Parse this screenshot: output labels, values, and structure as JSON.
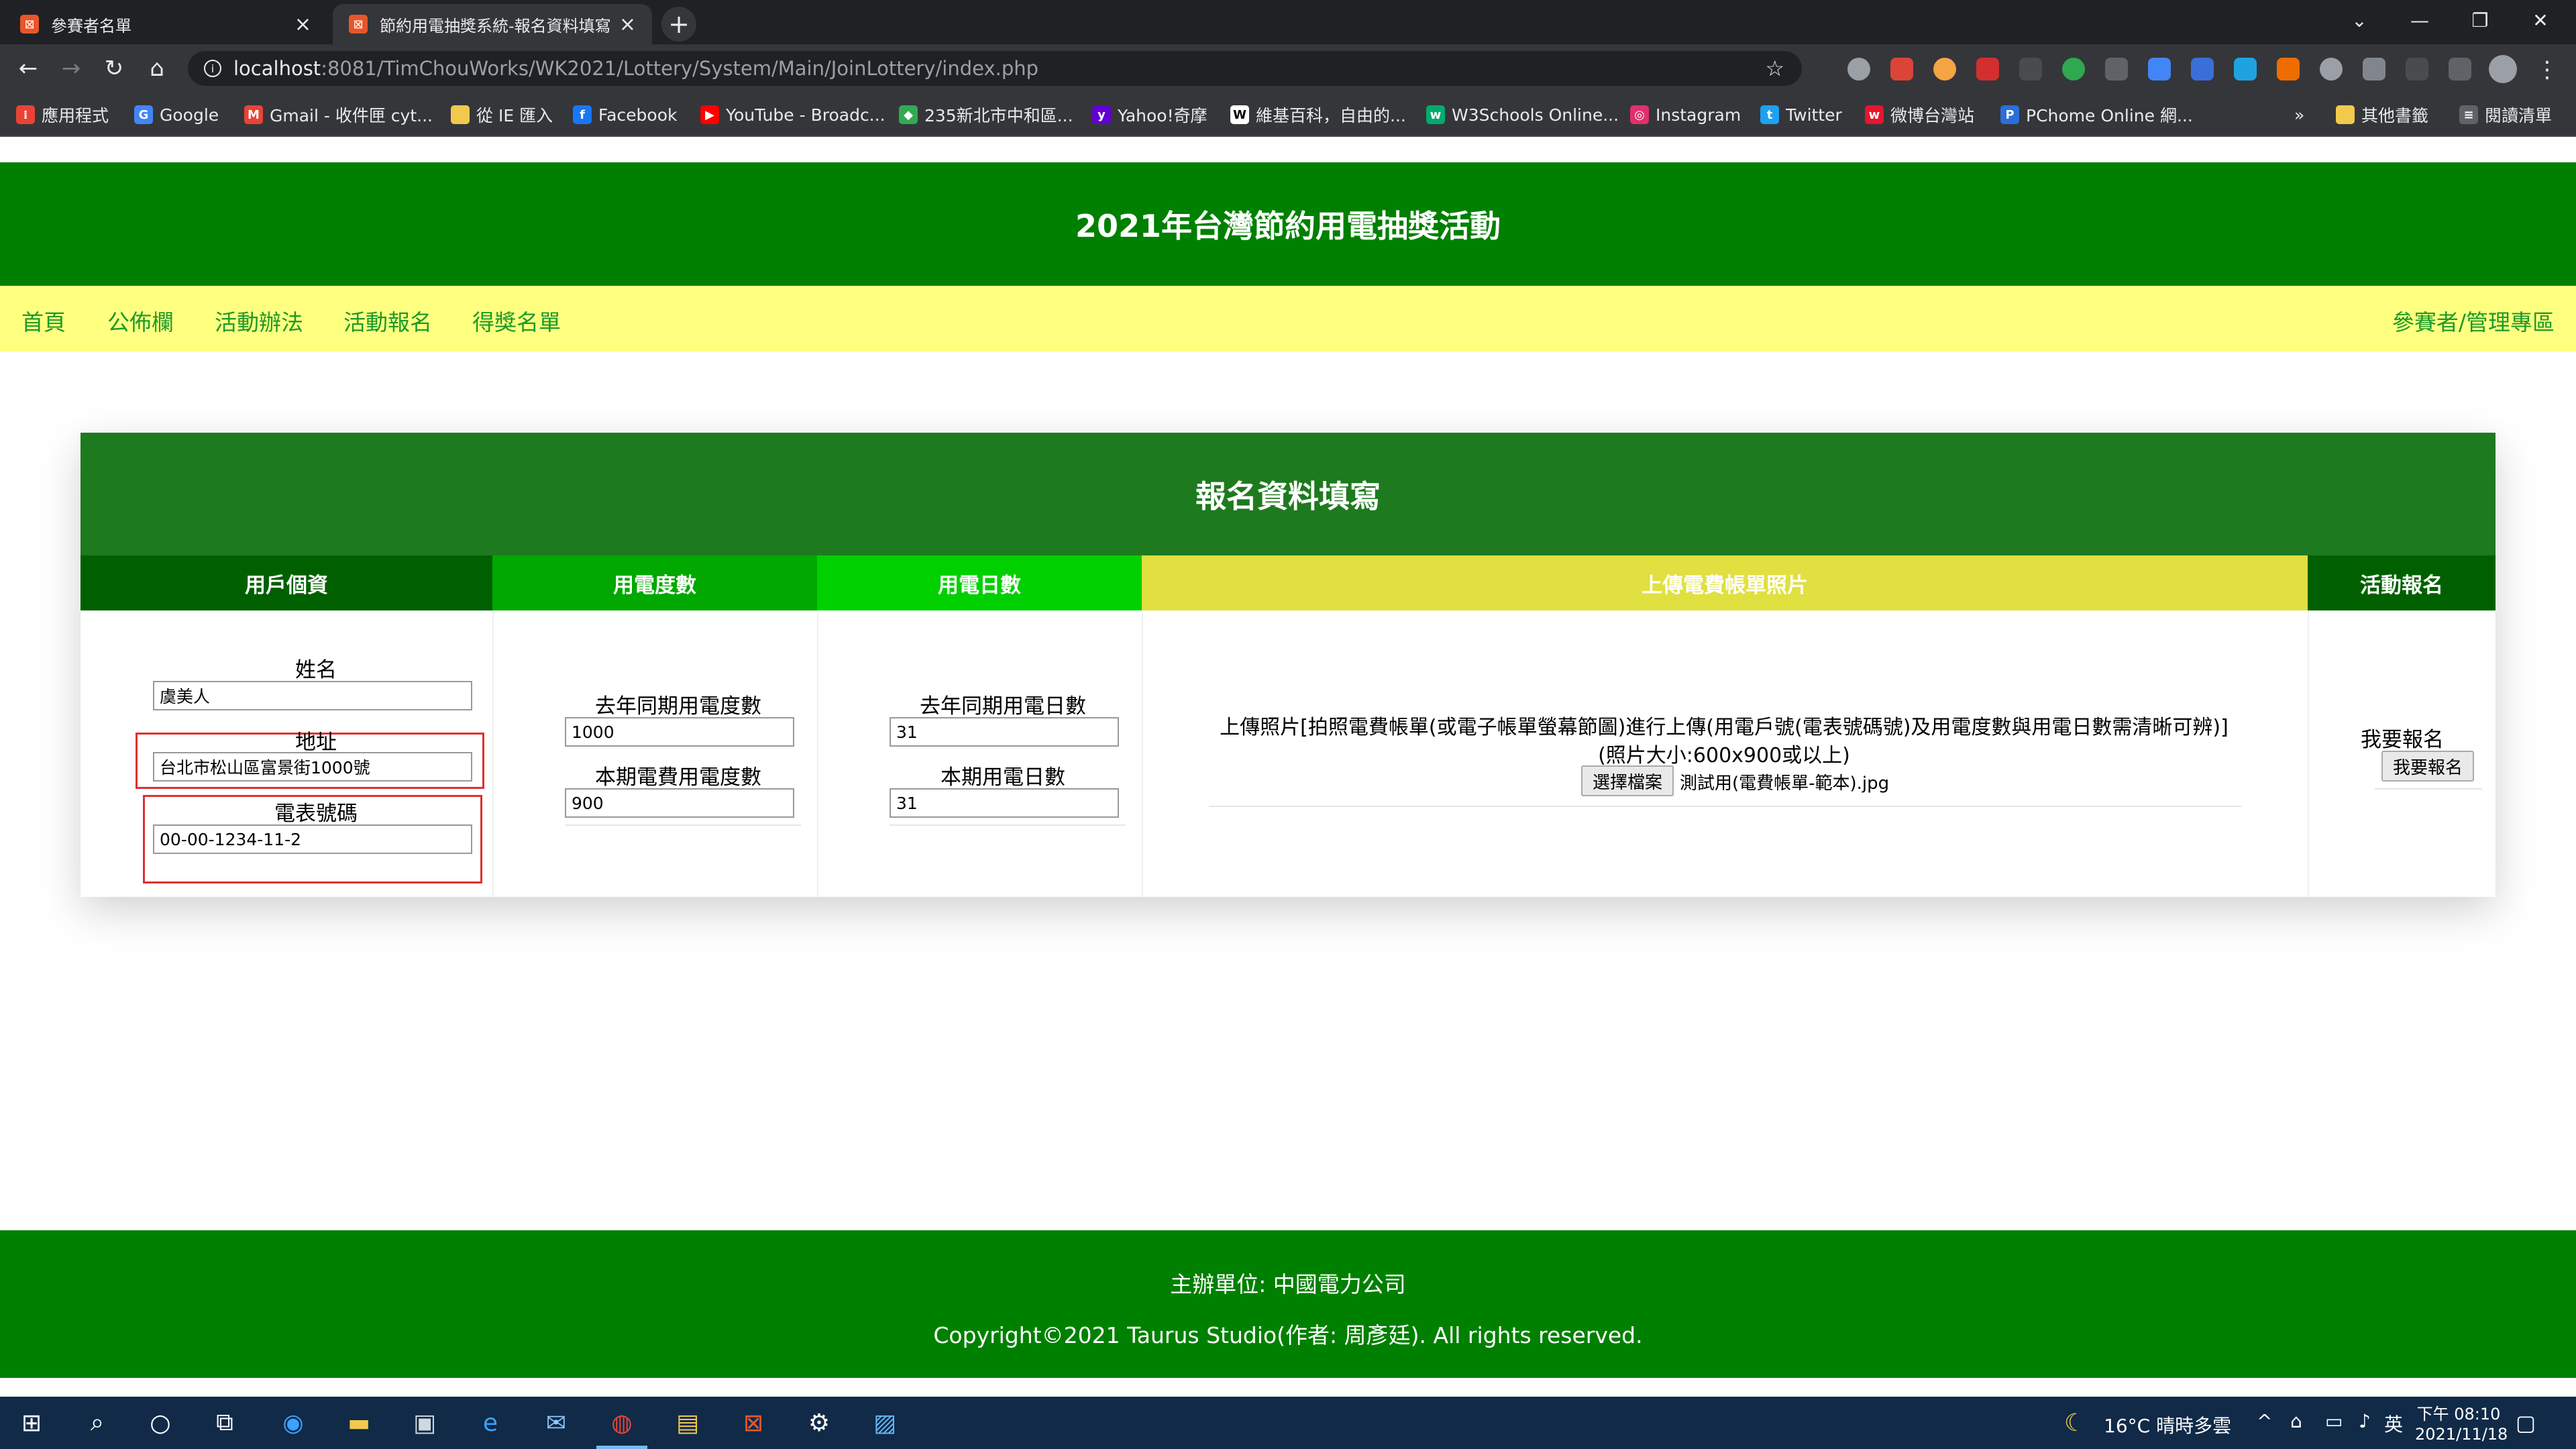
{
  "browser": {
    "tabs": [
      {
        "title": "參賽者名單",
        "active": false
      },
      {
        "title": "節約用電抽獎系統-報名資料填寫",
        "active": true
      }
    ],
    "url_host": "localhost",
    "url_path": ":8081/TimChouWorks/WK2021/Lottery/System/Main/JoinLottery/index.php",
    "bookmarks": [
      {
        "label": "應用程式",
        "icon": "apps-grid-icon",
        "color": "#ea4335"
      },
      {
        "label": "Google",
        "icon": "google-icon",
        "color": "#4285f4"
      },
      {
        "label": "Gmail - 收件匣 cyt...",
        "icon": "gmail-icon",
        "color": "#ea4335"
      },
      {
        "label": "從 IE 匯入",
        "icon": "folder-icon",
        "color": "#f2c94c"
      },
      {
        "label": "Facebook",
        "icon": "facebook-icon",
        "color": "#1877f2"
      },
      {
        "label": "YouTube - Broadc...",
        "icon": "youtube-icon",
        "color": "#ff0000"
      },
      {
        "label": "235新北市中和區...",
        "icon": "maps-icon",
        "color": "#34a853"
      },
      {
        "label": "Yahoo!奇摩",
        "icon": "yahoo-icon",
        "color": "#6001d2"
      },
      {
        "label": "維基百科，自由的...",
        "icon": "wikipedia-icon",
        "color": "#ffffff"
      },
      {
        "label": "W3Schools Online...",
        "icon": "w3schools-icon",
        "color": "#04aa6d"
      },
      {
        "label": "Instagram",
        "icon": "instagram-icon",
        "color": "#e1306c"
      },
      {
        "label": "Twitter",
        "icon": "twitter-icon",
        "color": "#1da1f2"
      },
      {
        "label": "微博台灣站",
        "icon": "weibo-icon",
        "color": "#e6162d"
      },
      {
        "label": "PChome Online 網...",
        "icon": "pchome-icon",
        "color": "#2a6fdb"
      }
    ],
    "bookmarks_more": "»",
    "other_bookmarks": "其他書籤",
    "reading_list": "閱讀清單"
  },
  "page": {
    "site_title": "2021年台灣節約用電抽獎活動",
    "nav": [
      "首頁",
      "公佈欄",
      "活動辦法",
      "活動報名",
      "得獎名單"
    ],
    "nav_right": "參賽者/管理專區",
    "form_title": "報名資料填寫",
    "columns": [
      {
        "label": "用戶個資",
        "color": "#006000"
      },
      {
        "label": "用電度數",
        "color": "#00a800"
      },
      {
        "label": "用電日數",
        "color": "#00d000"
      },
      {
        "label": "上傳電費帳單照片",
        "color": "#e0e040"
      },
      {
        "label": "活動報名",
        "color": "#006000"
      }
    ],
    "fields": {
      "name_label": "姓名",
      "name_value": "虞美人",
      "address_label": "地址",
      "address_value": "台北市松山區富景街1000號",
      "meter_label": "電表號碼",
      "meter_value": "00-00-1234-11-2",
      "last_year_kwh_label": "去年同期用電度數",
      "last_year_kwh_value": "1000",
      "this_kwh_label": "本期電費用電度數",
      "this_kwh_value": "900",
      "last_year_days_label": "去年同期用電日數",
      "last_year_days_value": "31",
      "this_days_label": "本期用電日數",
      "this_days_value": "31"
    },
    "upload": {
      "instruction": "上傳照片[拍照電費帳單(或電子帳單螢幕節圖)進行上傳(用電戶號(電表號碼號)及用電度數與用電日數需清晰可辨)]",
      "size_note": "(照片大小:600x900或以上)",
      "choose_button": "選擇檔案",
      "file_name": "測試用(電費帳單-範本).jpg"
    },
    "signup": {
      "label": "我要報名",
      "button": "我要報名"
    },
    "footer": {
      "organizer": "主辦單位: 中國電力公司",
      "copyright": "Copyright©2021 Taurus Studio(作者: 周彥廷). All rights reserved."
    }
  },
  "taskbar": {
    "weather": "16°C  晴時多雲",
    "ime": "英",
    "time": "下午 08:10",
    "date": "2021/11/18"
  }
}
